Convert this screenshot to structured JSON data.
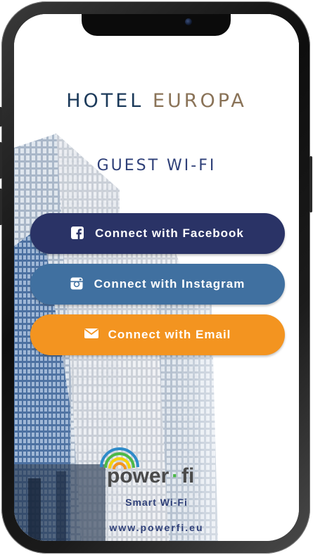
{
  "hotel": {
    "name_part1": "HOTEL",
    "name_part2": "EUROPA"
  },
  "subtitle": "GUEST WI-FI",
  "buttons": {
    "facebook": {
      "label": "Connect with Facebook",
      "icon": "facebook-icon",
      "color": "#2a3366"
    },
    "instagram": {
      "label": "Connect with Instagram",
      "icon": "instagram-icon",
      "color": "#4070a0"
    },
    "email": {
      "label": "Connect with Email",
      "icon": "envelope-icon",
      "color": "#f39420"
    }
  },
  "branding": {
    "logo_text_1": "power",
    "logo_dot": "·",
    "logo_text_2": "fi",
    "tagline": "Smart Wi-Fi",
    "url": "www.powerfi.eu"
  },
  "colors": {
    "navy": "#2e3f78",
    "gold": "#8a7358"
  }
}
